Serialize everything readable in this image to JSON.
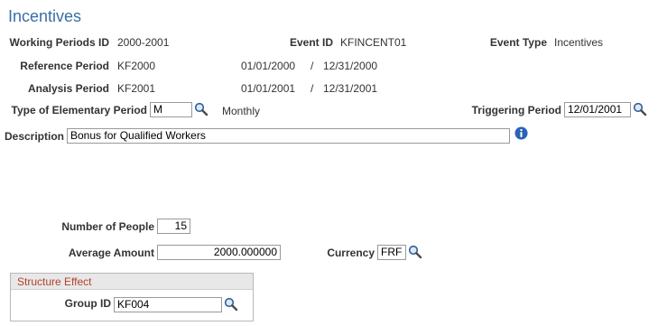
{
  "page": {
    "title": "Incentives"
  },
  "fields": {
    "working_periods_id": {
      "label": "Working Periods ID",
      "value": "2000-2001"
    },
    "event_id": {
      "label": "Event ID",
      "value": "KFINCENT01"
    },
    "event_type": {
      "label": "Event Type",
      "value": "Incentives"
    },
    "reference_period": {
      "label": "Reference Period",
      "value": "KF2000",
      "start": "01/01/2000",
      "sep": "/",
      "end": "12/31/2000"
    },
    "analysis_period": {
      "label": "Analysis Period",
      "value": "KF2001",
      "start": "01/01/2001",
      "sep": "/",
      "end": "12/31/2001"
    },
    "elementary_period": {
      "label": "Type of Elementary Period",
      "value": "M",
      "desc": "Monthly"
    },
    "triggering_period": {
      "label": "Triggering Period",
      "value": "12/01/2001"
    },
    "description": {
      "label": "Description",
      "value": "Bonus for Qualified Workers"
    },
    "number_of_people": {
      "label": "Number of People",
      "value": "15"
    },
    "average_amount": {
      "label": "Average Amount",
      "value": "2000.000000"
    },
    "currency": {
      "label": "Currency",
      "value": "FRF"
    }
  },
  "structure_effect": {
    "title": "Structure Effect",
    "group_id": {
      "label": "Group ID",
      "value": "KF004"
    }
  },
  "icons": {
    "lookup": "magnifier-icon",
    "info": "info-icon"
  },
  "colors": {
    "title": "#3a6ea5",
    "section_title": "#b5402a",
    "info": "#2a62b8"
  }
}
